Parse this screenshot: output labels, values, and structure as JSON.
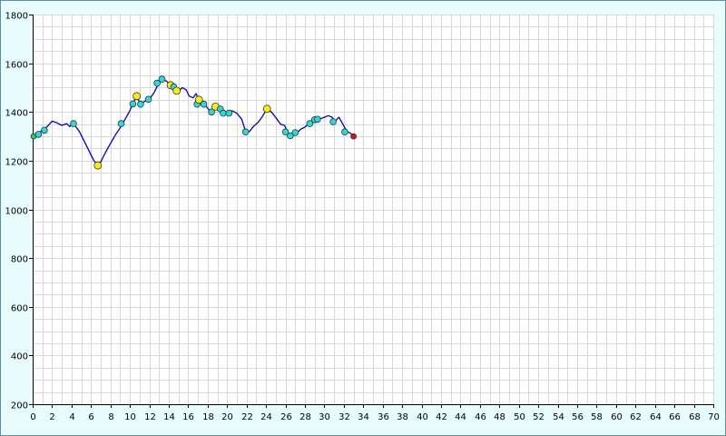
{
  "chart_data": {
    "type": "line",
    "title": "",
    "xlabel": "",
    "ylabel": "",
    "xlim": [
      0,
      70
    ],
    "ylim": [
      200,
      1800
    ],
    "x_ticks": [
      0,
      2,
      4,
      6,
      8,
      10,
      12,
      14,
      16,
      18,
      20,
      22,
      24,
      26,
      28,
      30,
      32,
      34,
      36,
      38,
      40,
      42,
      44,
      46,
      48,
      50,
      52,
      54,
      56,
      58,
      60,
      62,
      64,
      66,
      68,
      70
    ],
    "y_ticks": [
      200,
      400,
      600,
      800,
      1000,
      1200,
      1400,
      1600,
      1800
    ],
    "grid": true,
    "colors": {
      "line": "#0000cc",
      "background": "#e8fcfe",
      "plot_area": "#ffffff",
      "grid": "#d8d8d8",
      "marker_cyan": "#22dddd",
      "marker_yellow": "#ffee00",
      "marker_start": "#22cc55",
      "marker_end": "#dd1111"
    },
    "series": [
      {
        "name": "",
        "points": [
          [
            0.0,
            1300
          ],
          [
            0.5,
            1310
          ],
          [
            1.0,
            1325
          ],
          [
            1.5,
            1340
          ],
          [
            2.0,
            1362
          ],
          [
            2.5,
            1355
          ],
          [
            3.0,
            1345
          ],
          [
            3.5,
            1352
          ],
          [
            3.8,
            1340
          ],
          [
            4.2,
            1352
          ],
          [
            4.8,
            1320
          ],
          [
            5.3,
            1280
          ],
          [
            5.8,
            1240
          ],
          [
            6.3,
            1200
          ],
          [
            6.7,
            1180
          ],
          [
            7.0,
            1195
          ],
          [
            7.5,
            1235
          ],
          [
            8.0,
            1270
          ],
          [
            8.5,
            1305
          ],
          [
            9.0,
            1335
          ],
          [
            9.5,
            1370
          ],
          [
            10.0,
            1405
          ],
          [
            10.3,
            1435
          ],
          [
            10.7,
            1465
          ],
          [
            11.1,
            1432
          ],
          [
            11.5,
            1443
          ],
          [
            12.0,
            1452
          ],
          [
            12.5,
            1480
          ],
          [
            13.0,
            1520
          ],
          [
            13.4,
            1535
          ],
          [
            13.8,
            1525
          ],
          [
            14.2,
            1510
          ],
          [
            14.6,
            1500
          ],
          [
            15.0,
            1485
          ],
          [
            15.4,
            1500
          ],
          [
            15.8,
            1490
          ],
          [
            16.1,
            1465
          ],
          [
            16.5,
            1458
          ],
          [
            16.8,
            1475
          ],
          [
            17.1,
            1450
          ],
          [
            17.4,
            1440
          ],
          [
            17.8,
            1425
          ],
          [
            18.2,
            1405
          ],
          [
            18.5,
            1405
          ],
          [
            18.9,
            1420
          ],
          [
            19.3,
            1410
          ],
          [
            19.7,
            1395
          ],
          [
            20.0,
            1398
          ],
          [
            20.5,
            1405
          ],
          [
            21.0,
            1395
          ],
          [
            21.5,
            1370
          ],
          [
            21.9,
            1320
          ],
          [
            22.3,
            1320
          ],
          [
            22.7,
            1340
          ],
          [
            23.2,
            1358
          ],
          [
            23.6,
            1380
          ],
          [
            24.1,
            1413
          ],
          [
            24.6,
            1398
          ],
          [
            25.1,
            1372
          ],
          [
            25.5,
            1350
          ],
          [
            25.9,
            1345
          ],
          [
            26.2,
            1320
          ],
          [
            26.5,
            1302
          ],
          [
            26.8,
            1310
          ],
          [
            27.2,
            1315
          ],
          [
            27.6,
            1330
          ],
          [
            28.0,
            1338
          ],
          [
            28.4,
            1352
          ],
          [
            28.8,
            1365
          ],
          [
            29.2,
            1370
          ],
          [
            29.6,
            1372
          ],
          [
            30.0,
            1378
          ],
          [
            30.4,
            1385
          ],
          [
            30.8,
            1378
          ],
          [
            31.1,
            1362
          ],
          [
            31.5,
            1378
          ],
          [
            31.9,
            1350
          ],
          [
            32.3,
            1320
          ],
          [
            32.7,
            1312
          ],
          [
            33.0,
            1300
          ]
        ],
        "markers": [
          {
            "x": 0.1,
            "y": 1300,
            "color": "start"
          },
          {
            "x": 0.6,
            "y": 1308,
            "color": "cyan"
          },
          {
            "x": 1.2,
            "y": 1325,
            "color": "cyan"
          },
          {
            "x": 4.2,
            "y": 1352,
            "color": "cyan"
          },
          {
            "x": 6.7,
            "y": 1180,
            "color": "yellow"
          },
          {
            "x": 9.1,
            "y": 1352,
            "color": "cyan"
          },
          {
            "x": 10.3,
            "y": 1433,
            "color": "cyan"
          },
          {
            "x": 10.7,
            "y": 1465,
            "color": "yellow"
          },
          {
            "x": 11.1,
            "y": 1432,
            "color": "cyan"
          },
          {
            "x": 11.9,
            "y": 1452,
            "color": "cyan"
          },
          {
            "x": 12.8,
            "y": 1518,
            "color": "cyan"
          },
          {
            "x": 13.3,
            "y": 1535,
            "color": "cyan"
          },
          {
            "x": 14.2,
            "y": 1510,
            "color": "yellow"
          },
          {
            "x": 14.5,
            "y": 1503,
            "color": "cyan"
          },
          {
            "x": 14.8,
            "y": 1487,
            "color": "yellow"
          },
          {
            "x": 16.9,
            "y": 1432,
            "color": "cyan"
          },
          {
            "x": 17.1,
            "y": 1450,
            "color": "yellow"
          },
          {
            "x": 17.6,
            "y": 1432,
            "color": "cyan"
          },
          {
            "x": 18.4,
            "y": 1400,
            "color": "cyan"
          },
          {
            "x": 18.8,
            "y": 1422,
            "color": "yellow"
          },
          {
            "x": 19.3,
            "y": 1412,
            "color": "cyan"
          },
          {
            "x": 19.6,
            "y": 1395,
            "color": "cyan"
          },
          {
            "x": 20.2,
            "y": 1395,
            "color": "cyan"
          },
          {
            "x": 21.9,
            "y": 1318,
            "color": "cyan"
          },
          {
            "x": 24.1,
            "y": 1413,
            "color": "yellow"
          },
          {
            "x": 26.0,
            "y": 1318,
            "color": "cyan"
          },
          {
            "x": 26.5,
            "y": 1302,
            "color": "cyan"
          },
          {
            "x": 27.0,
            "y": 1315,
            "color": "cyan"
          },
          {
            "x": 28.5,
            "y": 1352,
            "color": "cyan"
          },
          {
            "x": 29.0,
            "y": 1368,
            "color": "cyan"
          },
          {
            "x": 29.3,
            "y": 1370,
            "color": "cyan"
          },
          {
            "x": 30.9,
            "y": 1360,
            "color": "cyan"
          },
          {
            "x": 32.1,
            "y": 1318,
            "color": "cyan"
          },
          {
            "x": 33.0,
            "y": 1300,
            "color": "end"
          }
        ]
      }
    ]
  }
}
